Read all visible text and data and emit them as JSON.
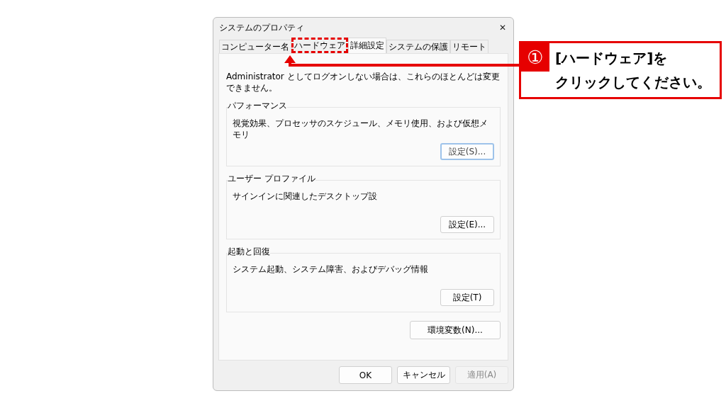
{
  "window": {
    "title": "システムのプロパティ",
    "close": "✕"
  },
  "tabs": [
    {
      "label": "コンピューター名",
      "selected": false,
      "highlighted": false
    },
    {
      "label": "ハードウェア",
      "selected": false,
      "highlighted": true
    },
    {
      "label": "詳細設定",
      "selected": true,
      "highlighted": false
    },
    {
      "label": "システムの保護",
      "selected": false,
      "highlighted": false
    },
    {
      "label": "リモート",
      "selected": false,
      "highlighted": false
    }
  ],
  "notice": "Administrator としてログオンしない場合は、これらのほとんどは変更できません。",
  "groups": [
    {
      "title": "パフォーマンス",
      "description": "視覚効果、プロセッサのスケジュール、メモリ使用、および仮想メモリ",
      "button": "設定(S)...",
      "focused": true
    },
    {
      "title": "ユーザー プロファイル",
      "description": "サインインに関連したデスクトップ設",
      "button": "設定(E)...",
      "focused": false
    },
    {
      "title": "起動と回復",
      "description": "システム起動、システム障害、およびデバッグ情報",
      "button": "設定(T)",
      "focused": false
    }
  ],
  "env_button": "環境変数(N)...",
  "buttons": [
    {
      "label": "OK",
      "disabled": false
    },
    {
      "label": "キャンセル",
      "disabled": false
    },
    {
      "label": "適用(A)",
      "disabled": true
    }
  ],
  "callout": {
    "number": "①",
    "lines": [
      "[ハードウェア]を",
      "クリックしてください。"
    ]
  }
}
